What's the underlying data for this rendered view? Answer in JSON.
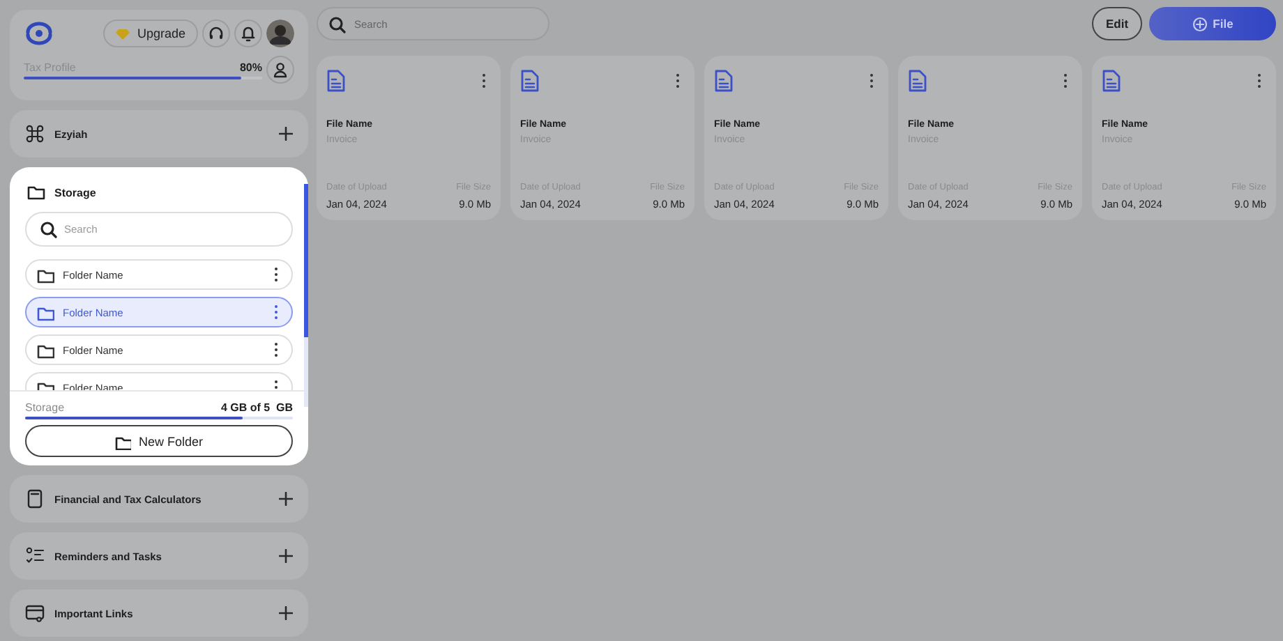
{
  "header": {
    "upgrade": "Upgrade",
    "profile": {
      "label": "Tax Profile",
      "reading": "80%",
      "level": 0.91
    }
  },
  "sections_top": [
    {
      "kind": "command",
      "title": "Ezyiah"
    }
  ],
  "storage": {
    "title": "Storage",
    "search": {
      "placeholder": "Search"
    },
    "folders": [
      {
        "name": "Folder Name",
        "selected": false
      },
      {
        "name": "Folder Name",
        "selected": true
      },
      {
        "name": "Folder Name",
        "selected": false
      },
      {
        "name": "Folder Name",
        "selected": false
      }
    ],
    "usage": {
      "label": "Storage",
      "reading": "4 GB of 5  GB",
      "level": 0.81
    },
    "new_folder": "New Folder"
  },
  "sections_bottom": [
    {
      "kind": "calculator",
      "title": "Financial and Tax Calculators"
    },
    {
      "kind": "tasks",
      "title": "Reminders and Tasks"
    },
    {
      "kind": "links",
      "title": "Important Links"
    }
  ],
  "toolbar": {
    "search": {
      "placeholder": "Search"
    },
    "edit": "Edit",
    "add": "File"
  },
  "files": [
    {
      "name": "File Name",
      "type": "Invoice",
      "date_label": "Date of Upload",
      "date": "Jan 04, 2024",
      "size_label": "File Size",
      "size": "9.0 Mb"
    },
    {
      "name": "File Name",
      "type": "Invoice",
      "date_label": "Date of Upload",
      "date": "Jan 04, 2024",
      "size_label": "File Size",
      "size": "9.0 Mb"
    },
    {
      "name": "File Name",
      "type": "Invoice",
      "date_label": "Date of Upload",
      "date": "Jan 04, 2024",
      "size_label": "File Size",
      "size": "9.0 Mb"
    },
    {
      "name": "File Name",
      "type": "Invoice",
      "date_label": "Date of Upload",
      "date": "Jan 04, 2024",
      "size_label": "File Size",
      "size": "9.0 Mb"
    },
    {
      "name": "File Name",
      "type": "Invoice",
      "date_label": "Date of Upload",
      "date": "Jan 04, 2024",
      "size_label": "File Size",
      "size": "9.0 Mb"
    }
  ]
}
